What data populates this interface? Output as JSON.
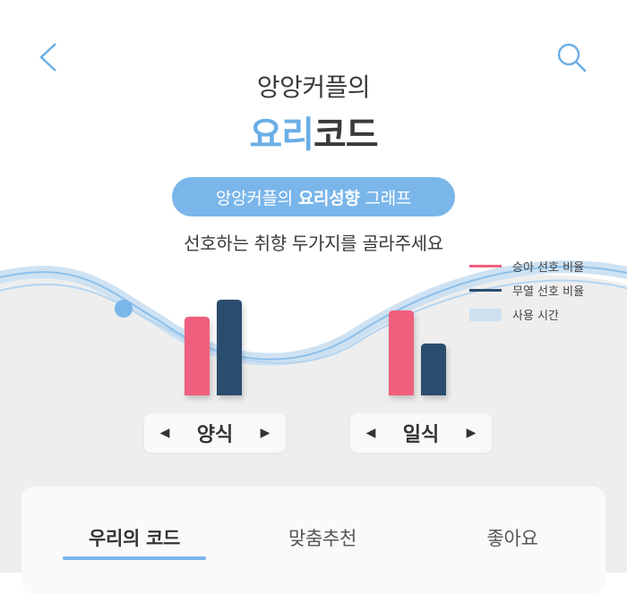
{
  "header": {
    "subtitle": "앙앙커플의",
    "title_highlight": "요리",
    "title_rest": "코드"
  },
  "pill": {
    "prefix": "앙앙커플의",
    "bold": "요리성향",
    "suffix": "그래프"
  },
  "instruction": "선호하는 취향 두가지를 골라주세요",
  "legend": [
    {
      "label": "승아 선호 비율",
      "color": "#f0607e",
      "kind": "line"
    },
    {
      "label": "무열 선호 비율",
      "color": "#2c4e6e",
      "kind": "line"
    },
    {
      "label": "사용 시간",
      "color": "#cfe1f1",
      "kind": "box"
    }
  ],
  "selectors": {
    "left": {
      "label": "양식",
      "prev": "◀",
      "next": "▶"
    },
    "right": {
      "label": "일식",
      "prev": "◀",
      "next": "▶"
    }
  },
  "tabs": [
    {
      "label": "우리의 코드",
      "active": true
    },
    {
      "label": "맞춤추천",
      "active": false
    },
    {
      "label": "좋아요",
      "active": false
    }
  ],
  "icons": {
    "back": "chevron-left-icon",
    "search": "search-icon"
  },
  "colors": {
    "accent": "#7ab6ea",
    "pink": "#f0607e",
    "navy": "#2c4e6e"
  },
  "chart_data": {
    "type": "bar",
    "categories": [
      "양식",
      "일식"
    ],
    "series": [
      {
        "name": "승아 선호 비율",
        "values": [
          88,
          95
        ]
      },
      {
        "name": "무열 선호 비율",
        "values": [
          107,
          58
        ]
      }
    ],
    "ylim": [
      0,
      110
    ]
  }
}
